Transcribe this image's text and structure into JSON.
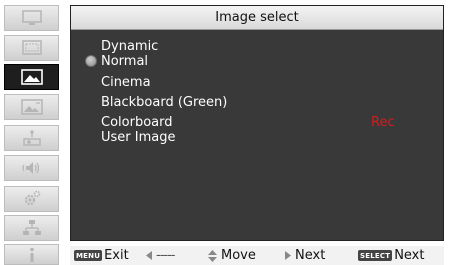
{
  "panel": {
    "title": "Image select",
    "items": [
      {
        "label": "Dynamic",
        "selected": false
      },
      {
        "label": "Normal",
        "selected": true
      },
      {
        "label": "Cinema",
        "selected": false
      },
      {
        "label": "Blackboard (Green)",
        "selected": false
      },
      {
        "label": "Colorboard",
        "selected": false
      },
      {
        "label": "User Image",
        "selected": false
      }
    ],
    "colorboard_badge": "Rec",
    "colors": {
      "background": "#393939",
      "title_bar": "#e6e6e6",
      "badge": "#d41c1c",
      "text": "#ffffff"
    }
  },
  "sidebar": {
    "items": [
      {
        "icon": "monitor-icon",
        "active": false
      },
      {
        "icon": "screen-icon",
        "active": false
      },
      {
        "icon": "image-icon",
        "active": true
      },
      {
        "icon": "image-adjust-icon",
        "active": false
      },
      {
        "icon": "projector-setting-icon",
        "active": false
      },
      {
        "icon": "sound-icon",
        "active": false
      },
      {
        "icon": "gear-icon",
        "active": false
      },
      {
        "icon": "network-icon",
        "active": false
      },
      {
        "icon": "info-icon",
        "active": false
      }
    ]
  },
  "help_bar": {
    "menu_key": "MENU",
    "exit": "Exit",
    "back_dashes": "-----",
    "move": "Move",
    "next": "Next",
    "select_key": "SELECT",
    "select_next": "Next"
  }
}
